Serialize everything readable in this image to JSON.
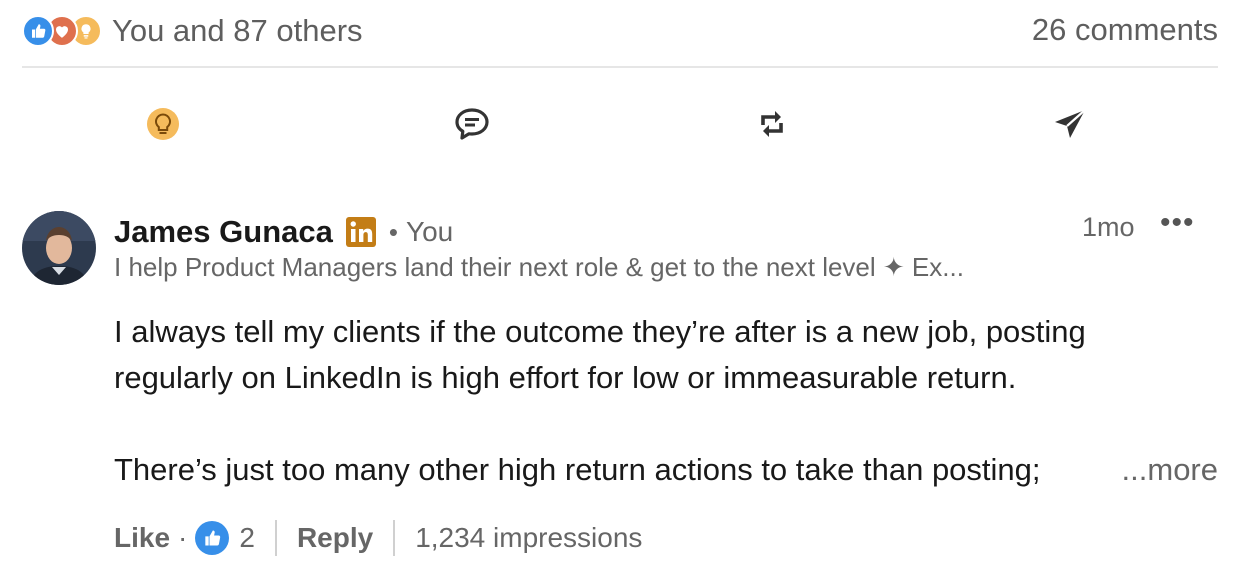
{
  "reactions_bar": {
    "reaction_icons": [
      "like-icon",
      "love-icon",
      "insightful-icon"
    ],
    "summary": "You and 87 others",
    "comments": "26 comments"
  },
  "action_bar": {
    "icons": [
      "insightful-icon",
      "comment-icon",
      "repost-icon",
      "send-icon"
    ]
  },
  "comment": {
    "author": "James Gunaca",
    "badge": "in",
    "relation": "You",
    "separator": "•",
    "time": "1mo",
    "menu": "•••",
    "headline": "I help Product Managers land their next role & get to the next level ✦ Ex...",
    "lines": [
      "I always tell my clients if the outcome they’re after is a new job, posting",
      "regularly on LinkedIn is high effort for low or immeasurable return.",
      "There’s just too many other high return actions to take than posting;"
    ],
    "see_more": "...more",
    "footer": {
      "like": "Like",
      "dot": "·",
      "like_count": "2",
      "reply": "Reply",
      "impressions": "1,234 impressions"
    }
  },
  "colors": {
    "like": "#378fe9",
    "love": "#df704d",
    "insightful": "#f5bb5c",
    "badge": "#c37d16"
  }
}
